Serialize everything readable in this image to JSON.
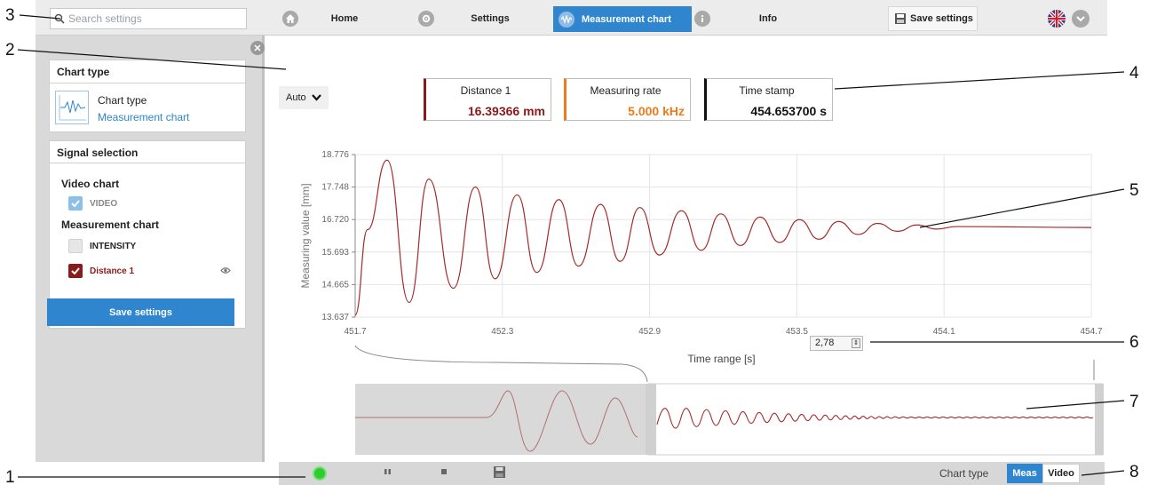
{
  "search": {
    "placeholder": "Search settings"
  },
  "nav": {
    "home": "Home",
    "settings": "Settings",
    "measurement_chart": "Measurement chart",
    "info": "Info",
    "save_settings": "Save settings"
  },
  "sidebar": {
    "chart_type_header": "Chart type",
    "chart_type_label": "Chart type",
    "chart_type_value": "Measurement chart",
    "signal_header": "Signal selection",
    "video_chart_label": "Video chart",
    "video_item": "VIDEO",
    "measurement_chart_label": "Measurement chart",
    "intensity_item": "INTENSITY",
    "distance_item": "Distance 1",
    "save_button": "Save settings"
  },
  "auto_select": "Auto",
  "values": {
    "distance_label": "Distance 1",
    "distance_value": "16.39366 mm",
    "rate_label": "Measuring rate",
    "rate_value": "5.000 kHz",
    "time_label": "Time stamp",
    "time_value": "454.653700 s"
  },
  "time_range_input": "2,78",
  "bottom": {
    "chart_type_label": "Chart type",
    "meas_button": "Meas",
    "video_button": "Video"
  },
  "callouts": [
    "1",
    "2",
    "3",
    "4",
    "5",
    "6",
    "7",
    "8"
  ],
  "colors": {
    "accent": "#2f86cf",
    "distance": "#8b1a1a",
    "rate": "#ee7b1b",
    "signal_line": "#a32b2b"
  },
  "chart_data": {
    "type": "line",
    "xlabel": "Time range [s]",
    "ylabel": "Measuring value [mm]",
    "xlim": [
      451.7,
      454.7
    ],
    "ylim": [
      13.637,
      18.776
    ],
    "x_ticks": [
      "451.7",
      "452.3",
      "452.9",
      "453.5",
      "454.1",
      "454.7"
    ],
    "y_ticks": [
      "18.776",
      "17.748",
      "16.720",
      "15.693",
      "14.665",
      "13.637"
    ],
    "grid": true,
    "series": [
      {
        "name": "Distance 1",
        "x": [
          451.7,
          451.75,
          451.83,
          451.92,
          452.0,
          452.1,
          452.19,
          452.27,
          452.36,
          452.44,
          452.53,
          452.61,
          452.7,
          452.78,
          452.86,
          452.94,
          453.03,
          453.11,
          453.19,
          453.27,
          453.35,
          453.43,
          453.51,
          453.59,
          453.67,
          453.75,
          453.83,
          453.91,
          453.99,
          454.07,
          454.15,
          454.7
        ],
        "values": [
          13.7,
          16.4,
          18.6,
          14.1,
          18.0,
          14.55,
          17.75,
          14.85,
          17.5,
          15.05,
          17.35,
          15.25,
          17.2,
          15.4,
          17.1,
          15.6,
          17.0,
          15.75,
          16.9,
          15.9,
          16.8,
          16.0,
          16.72,
          16.1,
          16.66,
          16.25,
          16.6,
          16.35,
          16.55,
          16.42,
          16.5,
          16.47
        ]
      }
    ]
  }
}
